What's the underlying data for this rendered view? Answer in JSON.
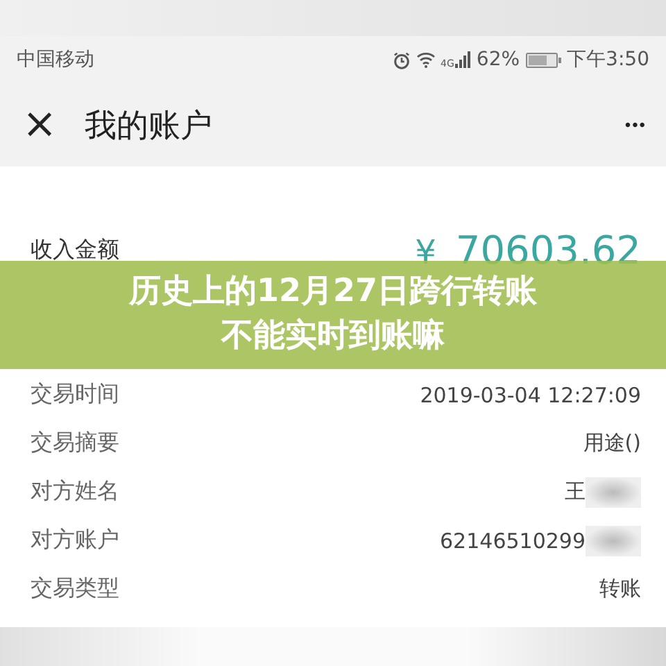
{
  "status_bar": {
    "carrier": "中国移动",
    "network": "4G",
    "battery": "62%",
    "time": "下午3:50"
  },
  "header": {
    "close": "×",
    "title": "我的账户",
    "more": "•••"
  },
  "amount": {
    "label": "收入金额",
    "currency": "¥",
    "value": "70603.62"
  },
  "details": [
    {
      "label": "交易时间",
      "value": "2019-03-04 12:27:09",
      "redacted": false
    },
    {
      "label": "交易摘要",
      "value": "用途()",
      "redacted": false
    },
    {
      "label": "对方姓名",
      "value": "王",
      "redacted": true
    },
    {
      "label": "对方账户",
      "value": "62146510299",
      "redacted": true
    },
    {
      "label": "交易类型",
      "value": "转账",
      "redacted": false
    }
  ],
  "banner": {
    "lines": [
      "历史上的12月27日跨行转账",
      "不能实时到账嘛"
    ]
  }
}
